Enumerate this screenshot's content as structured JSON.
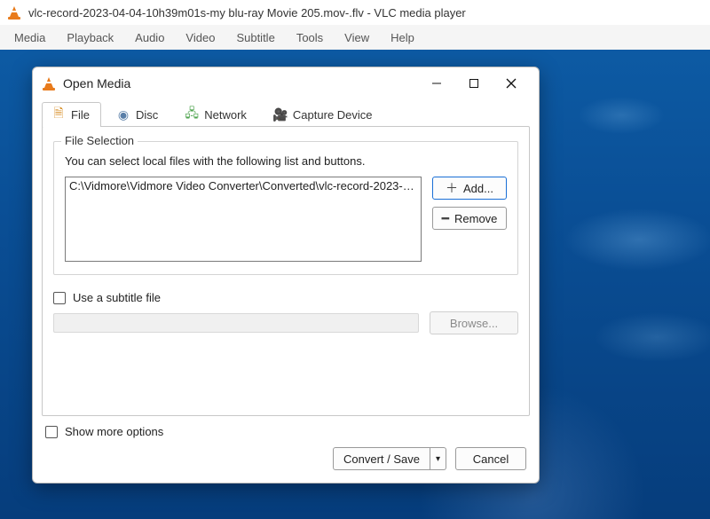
{
  "window": {
    "title": "vlc-record-2023-04-04-10h39m01s-my blu-ray Movie 205.mov-.flv - VLC media player"
  },
  "menubar": {
    "items": [
      "Media",
      "Playback",
      "Audio",
      "Video",
      "Subtitle",
      "Tools",
      "View",
      "Help"
    ]
  },
  "dialog": {
    "title": "Open Media",
    "tabs": {
      "file": "File",
      "disc": "Disc",
      "network": "Network",
      "capture": "Capture Device"
    },
    "file_selection": {
      "legend": "File Selection",
      "instruction": "You can select local files with the following list and buttons.",
      "entry": "C:\\Vidmore\\Vidmore Video Converter\\Converted\\vlc-record-2023-0...",
      "add_label": "Add...",
      "remove_label": "Remove"
    },
    "subtitle": {
      "checkbox_label": "Use a subtitle file",
      "browse_label": "Browse..."
    },
    "more_options_label": "Show more options",
    "convert_label": "Convert / Save",
    "cancel_label": "Cancel"
  }
}
